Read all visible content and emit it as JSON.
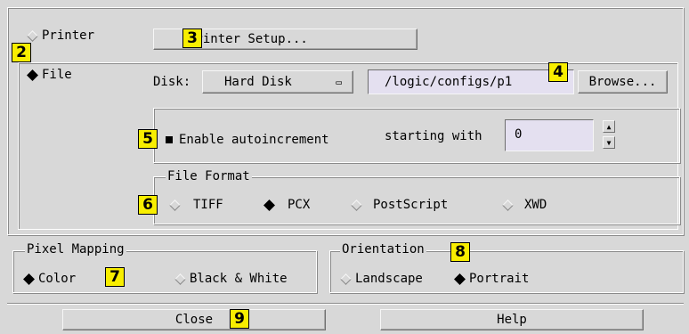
{
  "destination": {
    "printer": {
      "label": "Printer",
      "selected": false
    },
    "printer_setup": {
      "label": "Printer Setup..."
    },
    "file": {
      "label": "File",
      "selected": true
    },
    "disk": {
      "label": "Disk:",
      "value": "Hard Disk",
      "indicator": "▭"
    },
    "path": {
      "value": "/logic/configs/p1"
    },
    "browse": {
      "label": "Browse..."
    },
    "autoincrement": {
      "label": "Enable autoincrement",
      "checked": true,
      "starting_label": "starting with",
      "starting_value": "0"
    },
    "file_format": {
      "legend": "File Format",
      "options": [
        {
          "label": "TIFF",
          "selected": false
        },
        {
          "label": "PCX",
          "selected": true
        },
        {
          "label": "PostScript",
          "selected": false
        },
        {
          "label": "XWD",
          "selected": false
        }
      ]
    }
  },
  "pixel_mapping": {
    "legend": "Pixel Mapping",
    "options": [
      {
        "label": "Color",
        "selected": true
      },
      {
        "label": "Black & White",
        "selected": false
      }
    ]
  },
  "orientation": {
    "legend": "Orientation",
    "options": [
      {
        "label": "Landscape",
        "selected": false
      },
      {
        "label": "Portrait",
        "selected": true
      }
    ]
  },
  "footer": {
    "close": "Close",
    "help": "Help"
  },
  "callouts": {
    "c2": "2",
    "c3": "3",
    "c4": "4",
    "c5": "5",
    "c6": "6",
    "c7": "7",
    "c8": "8",
    "c9": "9"
  },
  "colors": {
    "background": "#d8d8d8",
    "field": "#e4e0f0",
    "callout": "#f8ee00"
  }
}
